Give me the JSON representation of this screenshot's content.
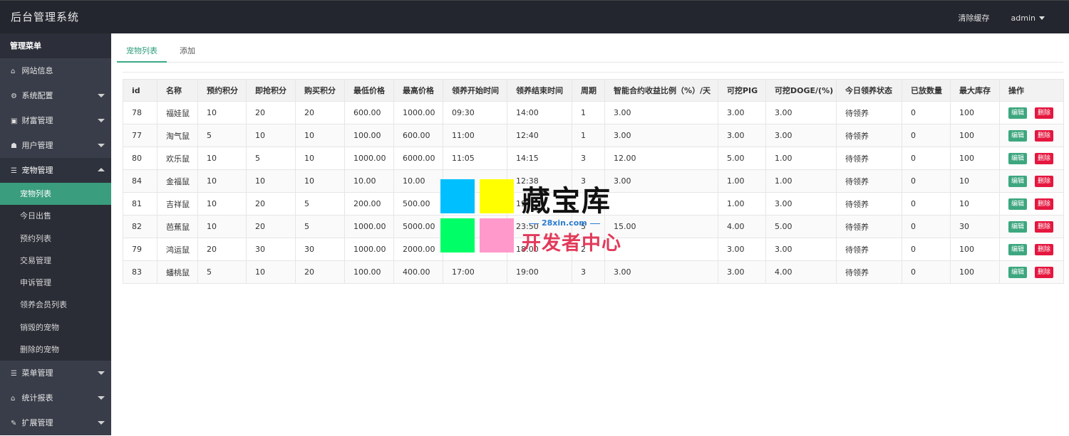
{
  "header": {
    "title": "后台管理系统",
    "clear_cache": "清除缓存",
    "user": "admin"
  },
  "sidebar": {
    "heading": "管理菜单",
    "items": [
      {
        "icon": "home-icon",
        "glyph": "⌂",
        "label": "网站信息"
      },
      {
        "icon": "gears-icon",
        "glyph": "⚙",
        "label": "系统配置"
      },
      {
        "icon": "money-icon",
        "glyph": "▣",
        "label": "财富管理"
      },
      {
        "icon": "users-icon",
        "glyph": "☗",
        "label": "用户管理"
      },
      {
        "icon": "list-icon",
        "glyph": "☰",
        "label": "宠物管理"
      },
      {
        "icon": "list-icon",
        "glyph": "☰",
        "label": "菜单管理"
      },
      {
        "icon": "home-icon",
        "glyph": "⌂",
        "label": "统计报表"
      },
      {
        "icon": "wrench-icon",
        "glyph": "✎",
        "label": "扩展管理"
      }
    ],
    "pet_sub": [
      "宠物列表",
      "今日出售",
      "预约列表",
      "交易管理",
      "申诉管理",
      "领养会员列表",
      "销毁的宠物",
      "删除的宠物"
    ]
  },
  "tabs": [
    "宠物列表",
    "添加"
  ],
  "table": {
    "headers": [
      "id",
      "名称",
      "预约积分",
      "即抢积分",
      "购买积分",
      "最低价格",
      "最高价格",
      "领养开始时间",
      "领养结束时间",
      "周期",
      "智能合约收益比例（%）/天",
      "可挖PIG",
      "可挖DOGE/(%)",
      "今日领养状态",
      "已放数量",
      "最大库存",
      "操作"
    ],
    "rows": [
      [
        "78",
        "福娃鼠",
        "10",
        "20",
        "20",
        "600.00",
        "1000.00",
        "09:30",
        "14:00",
        "1",
        "3.00",
        "3.00",
        "3.00",
        "待领养",
        "0",
        "100"
      ],
      [
        "77",
        "淘气鼠",
        "5",
        "10",
        "10",
        "100.00",
        "600.00",
        "11:00",
        "12:40",
        "1",
        "3.00",
        "3.00",
        "3.00",
        "待领养",
        "0",
        "100"
      ],
      [
        "80",
        "欢乐鼠",
        "10",
        "5",
        "10",
        "1000.00",
        "6000.00",
        "11:05",
        "14:15",
        "3",
        "12.00",
        "5.00",
        "1.00",
        "待领养",
        "0",
        "100"
      ],
      [
        "84",
        "金福鼠",
        "10",
        "10",
        "10",
        "10.00",
        "10.00",
        "",
        "12:38",
        "3",
        "3.00",
        "1.00",
        "1.00",
        "待领养",
        "0",
        "10"
      ],
      [
        "81",
        "吉祥鼠",
        "10",
        "20",
        "5",
        "200.00",
        "500.00",
        "",
        "19",
        "",
        "",
        "1.00",
        "3.00",
        "待领养",
        "0",
        "10"
      ],
      [
        "82",
        "芭蕉鼠",
        "10",
        "20",
        "5",
        "1000.00",
        "5000.00",
        "",
        "23:50",
        "5",
        "15.00",
        "4.00",
        "5.00",
        "待领养",
        "0",
        "30"
      ],
      [
        "79",
        "鸿运鼠",
        "20",
        "30",
        "30",
        "1000.00",
        "2000.00",
        "",
        "18:00",
        "2",
        "",
        "3.00",
        "3.00",
        "待领养",
        "0",
        "100"
      ],
      [
        "83",
        "蟠桃鼠",
        "5",
        "10",
        "20",
        "100.00",
        "400.00",
        "17:00",
        "19:00",
        "3",
        "3.00",
        "3.00",
        "4.00",
        "待领养",
        "0",
        "100"
      ]
    ],
    "edit_label": "编辑",
    "delete_label": "删除"
  },
  "watermark": {
    "title": "藏宝库",
    "url": "28xin.com",
    "subtitle": "开发者中心",
    "colors": [
      "#00bfff",
      "#ffff00",
      "#00ff66",
      "#ff99cc"
    ]
  }
}
